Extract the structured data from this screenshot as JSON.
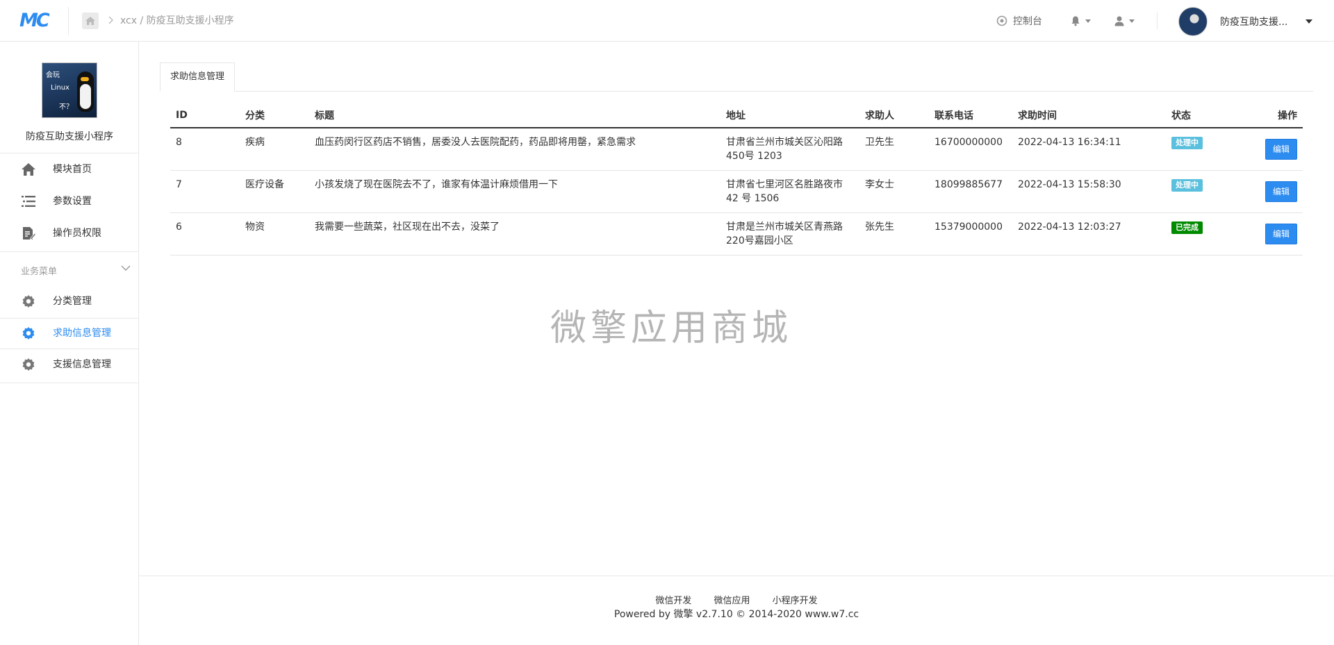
{
  "topbar": {
    "logo": "MC",
    "breadcrumb": "xcx / 防疫互助支援小程序",
    "console_label": "控制台",
    "account_name": "防疫互助支援..."
  },
  "sidebar": {
    "avatar_text": [
      "会玩",
      "Linux",
      "不？"
    ],
    "app_name": "防疫互助支援小程序",
    "items": [
      {
        "label": "模块首页",
        "icon": "home-icon"
      },
      {
        "label": "参数设置",
        "icon": "list-icon"
      },
      {
        "label": "操作员权限",
        "icon": "edit-doc-icon"
      }
    ],
    "group_label": "业务菜单",
    "group_items": [
      {
        "label": "分类管理",
        "icon": "gear-icon",
        "active": false
      },
      {
        "label": "求助信息管理",
        "icon": "gear-icon",
        "active": true
      },
      {
        "label": "支援信息管理",
        "icon": "gear-icon",
        "active": false
      }
    ]
  },
  "main": {
    "tab_label": "求助信息管理",
    "table": {
      "headers": [
        "ID",
        "分类",
        "标题",
        "地址",
        "求助人",
        "联系电话",
        "求助时间",
        "状态",
        "操作"
      ],
      "rows": [
        {
          "id": "8",
          "category": "疾病",
          "title": "血压药闵行区药店不销售，居委没人去医院配药，药品即将用罄，紧急需求",
          "address": "甘肃省兰州市城关区沁阳路450号 1203",
          "person": "卫先生",
          "phone": "16700000000",
          "time": "2022-04-13 16:34:11",
          "status": "处理中",
          "status_type": "processing",
          "action": "编辑"
        },
        {
          "id": "7",
          "category": "医疗设备",
          "title": "小孩发烧了现在医院去不了，谁家有体温计麻烦借用一下",
          "address": "甘肃省七里河区名胜路夜市42 号 1506",
          "person": "李女士",
          "phone": "18099885677",
          "time": "2022-04-13 15:58:30",
          "status": "处理中",
          "status_type": "processing",
          "action": "编辑"
        },
        {
          "id": "6",
          "category": "物资",
          "title": "我需要一些蔬菜，社区现在出不去，没菜了",
          "address": "甘肃是兰州市城关区青燕路220号嘉园小区",
          "person": "张先生",
          "phone": "15379000000",
          "time": "2022-04-13 12:03:27",
          "status": "已完成",
          "status_type": "done",
          "action": "编辑"
        }
      ]
    },
    "watermark": "微擎应用商城"
  },
  "footer": {
    "links": [
      "微信开发",
      "微信应用",
      "小程序开发"
    ],
    "copyright": "Powered by 微擎 v2.7.10 © 2014-2020 www.w7.cc"
  },
  "colors": {
    "accent": "#2d8cf0",
    "processing": "#5bc0de",
    "done": "#008a00"
  }
}
